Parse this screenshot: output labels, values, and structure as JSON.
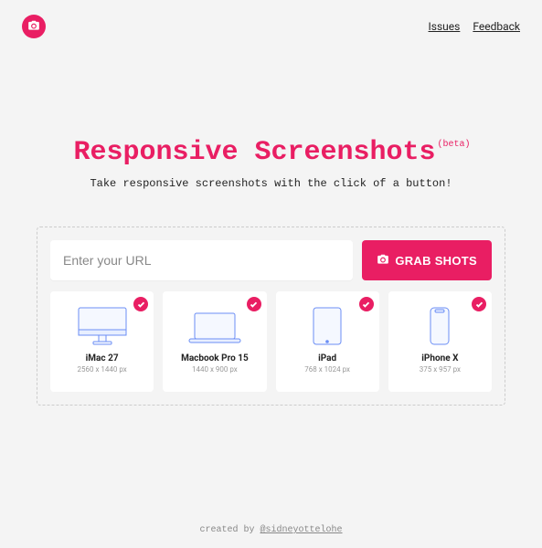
{
  "nav": {
    "issues": "Issues",
    "feedback": "Feedback"
  },
  "hero": {
    "title": "Responsive Screenshots",
    "beta": "(beta)",
    "subtitle": "Take responsive screenshots with the click of a button!"
  },
  "input": {
    "placeholder": "Enter your URL",
    "button": "GRAB SHOTS"
  },
  "devices": [
    {
      "name": "iMac 27",
      "res": "2560 x 1440 px"
    },
    {
      "name": "Macbook Pro 15",
      "res": "1440 x 900 px"
    },
    {
      "name": "iPad",
      "res": "768 x 1024 px"
    },
    {
      "name": "iPhone X",
      "res": "375 x 957 px"
    }
  ],
  "footer": {
    "prefix": "created by ",
    "author": "@sidneyottelohe"
  }
}
